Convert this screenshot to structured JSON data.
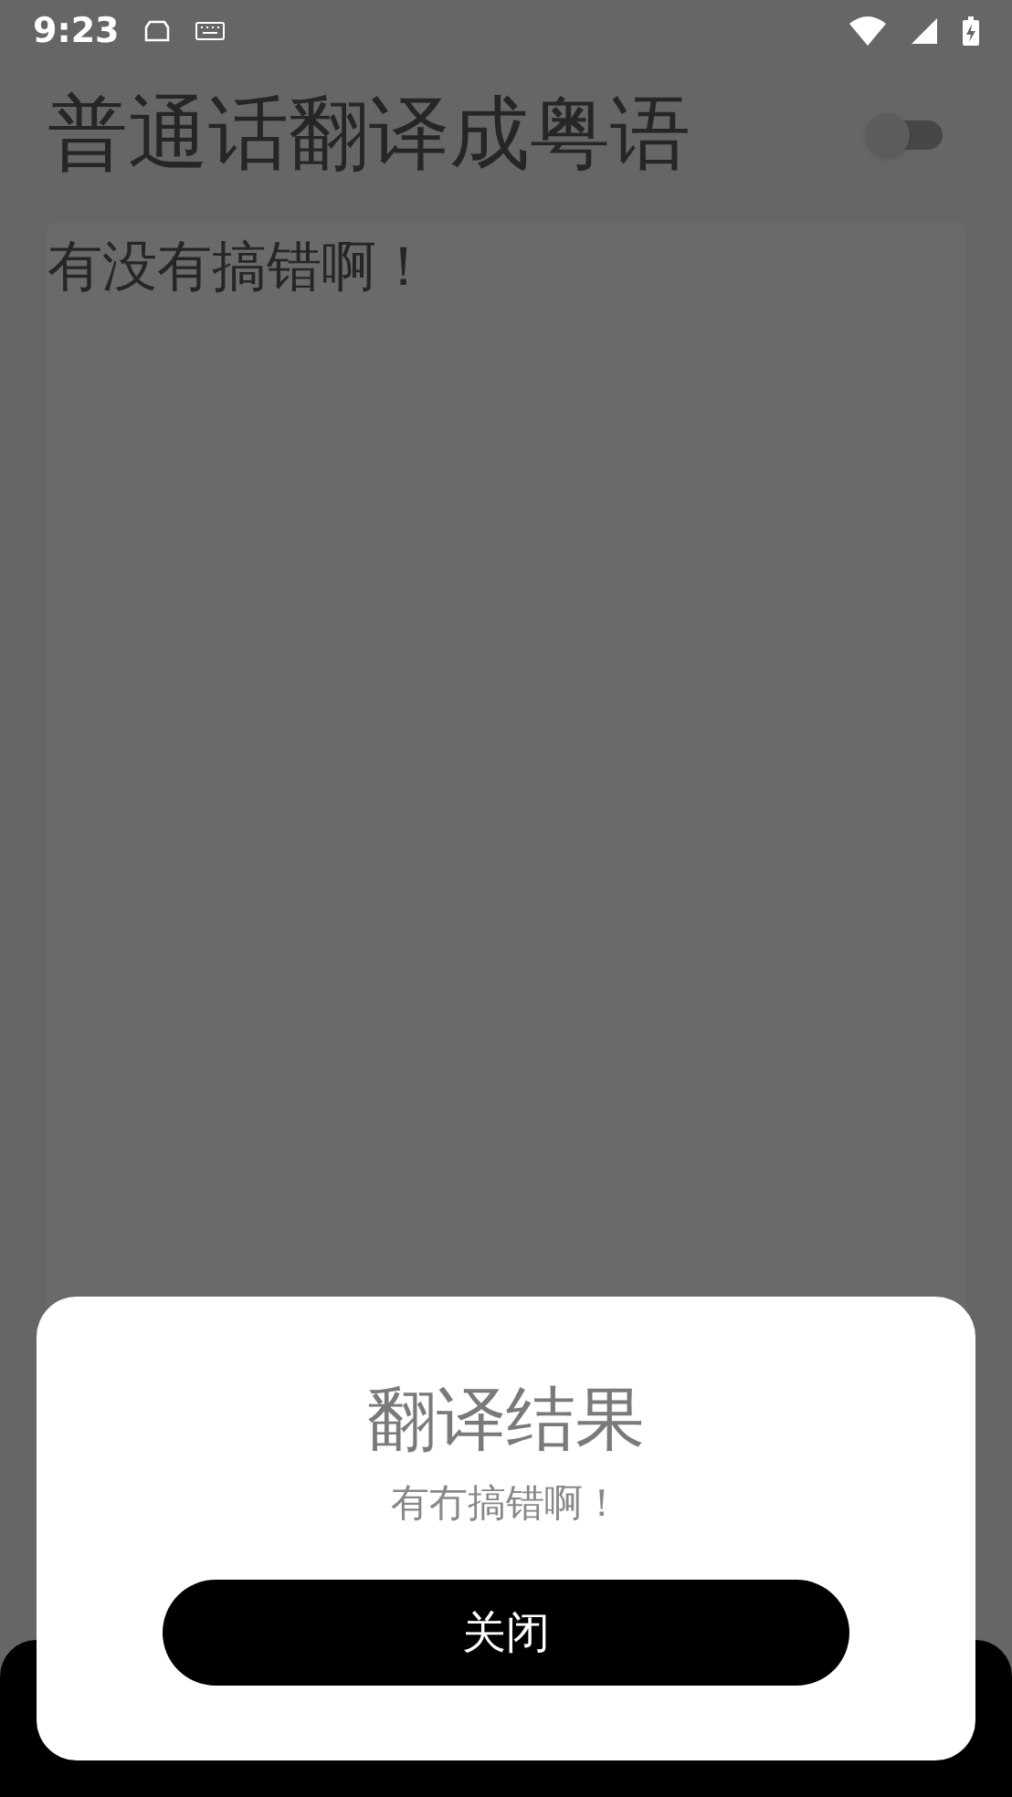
{
  "status_bar": {
    "time": "9:23"
  },
  "app": {
    "title": "普通话翻译成粤语",
    "toggle": {
      "on": false
    },
    "input": {
      "value": "有没有搞错啊！"
    }
  },
  "dialog": {
    "title": "翻译结果",
    "message": "有冇搞错啊！",
    "button": "关闭"
  }
}
